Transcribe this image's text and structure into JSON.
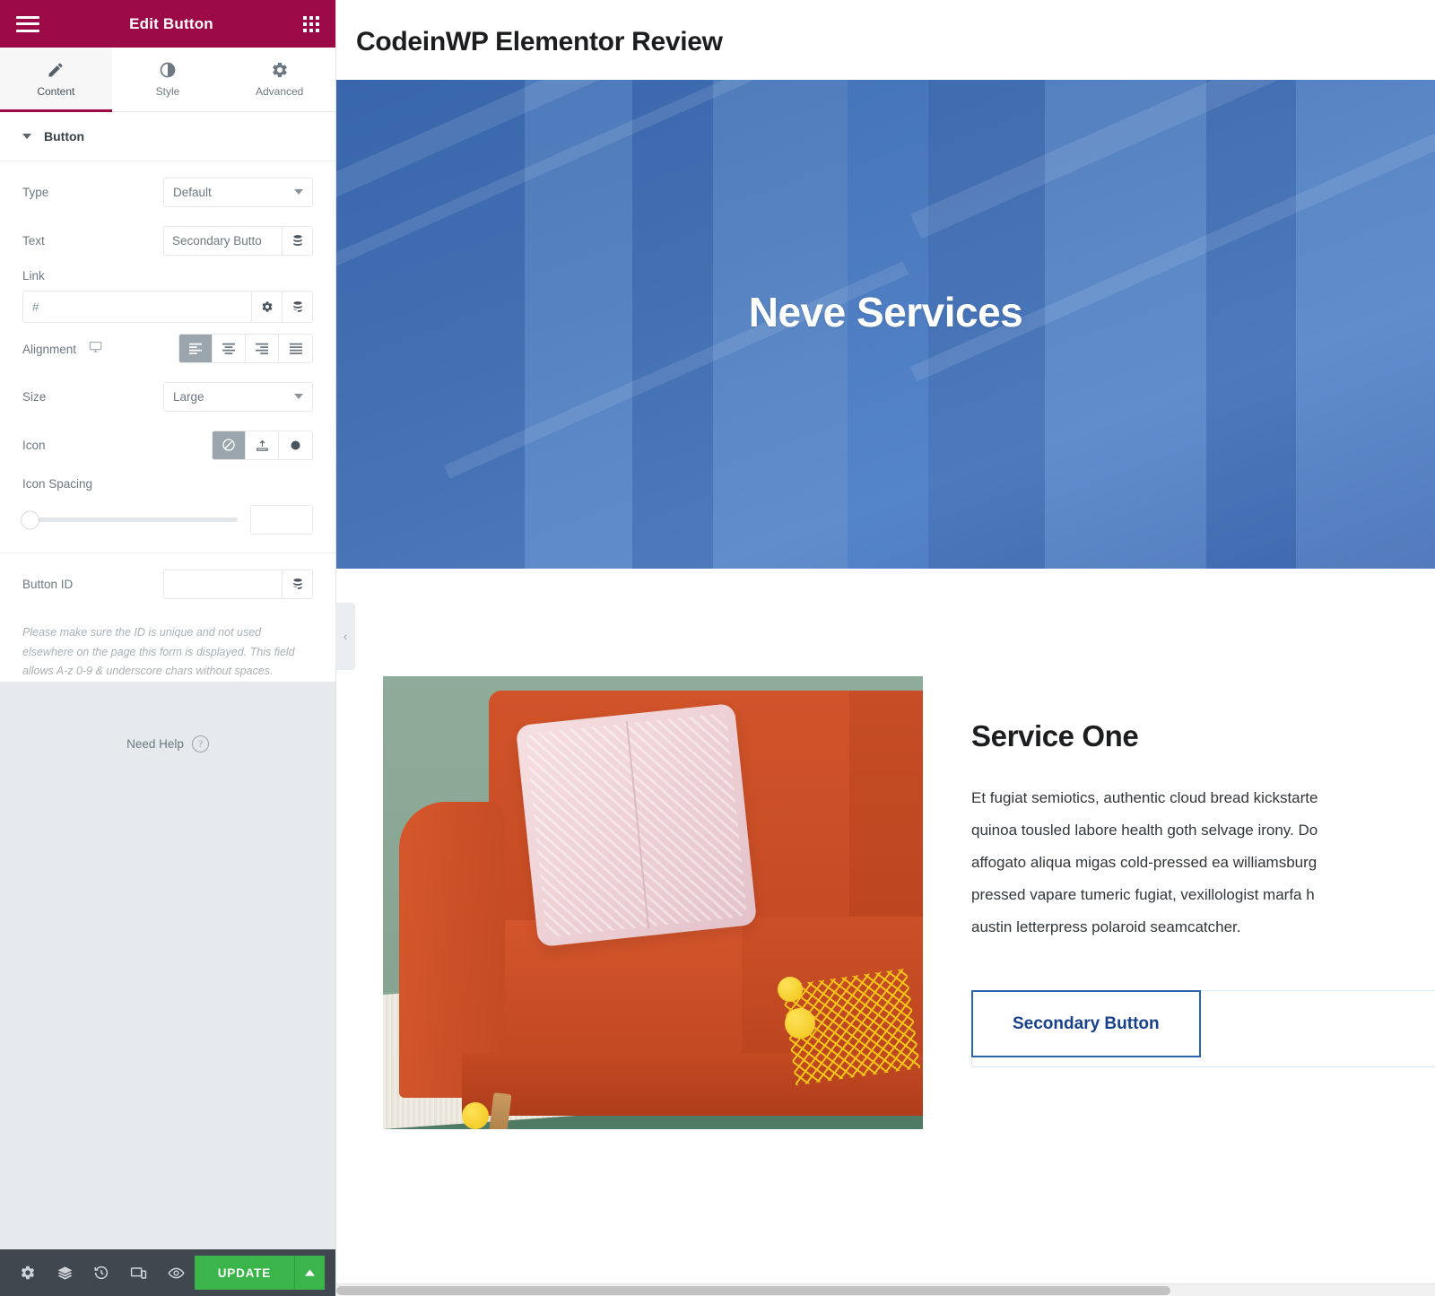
{
  "panel": {
    "header": {
      "title": "Edit Button",
      "menu_icon": "hamburger-icon",
      "apps_icon": "grid-apps-icon"
    },
    "tabs": [
      {
        "label": "Content",
        "icon": "pencil-icon",
        "active": true
      },
      {
        "label": "Style",
        "icon": "half-circle-icon",
        "active": false
      },
      {
        "label": "Advanced",
        "icon": "gear-icon",
        "active": false
      }
    ],
    "section": {
      "title": "Button",
      "collapsed": false
    },
    "fields": {
      "type_label": "Type",
      "type_value": "Default",
      "text_label": "Text",
      "text_value": "Secondary Butto",
      "link_label": "Link",
      "link_value": "#",
      "alignment_label": "Alignment",
      "alignment_options": [
        "align-left",
        "align-center",
        "align-right",
        "align-justify"
      ],
      "alignment_selected": "align-left",
      "size_label": "Size",
      "size_value": "Large",
      "icon_label": "Icon",
      "icon_options": [
        "no-icon",
        "upload-media-icon",
        "icon-library-circle"
      ],
      "icon_selected": "no-icon",
      "icon_spacing_label": "Icon Spacing",
      "icon_spacing_value": "",
      "button_id_label": "Button ID",
      "button_id_value": ""
    },
    "hint": "Please make sure the ID is unique and not used elsewhere on the page this form is displayed. This field allows A-z  0-9 & underscore chars without spaces.",
    "need_help": "Need Help",
    "footer": {
      "icons": [
        "settings-gear-icon",
        "navigator-layers-icon",
        "history-clock-icon",
        "responsive-mode-icon",
        "preview-eye-icon"
      ],
      "update_label": "UPDATE",
      "update_arrow_icon": "chevron-up-icon"
    },
    "collapse_tab_icon": "chevron-left-icon"
  },
  "preview": {
    "site_title": "CodeinWP Elementor Review",
    "hero_title": "Neve Services",
    "service": {
      "title": "Service One",
      "body_lines": [
        "Et fugiat semiotics, authentic cloud bread kickstarte",
        "quinoa tousled labore health goth selvage irony. Do",
        "affogato aliqua migas cold-pressed ea williamsburg",
        "pressed vapare tumeric fugiat, vexillologist marfa h",
        "austin letterpress polaroid seamcatcher."
      ],
      "button_label": "Secondary Button"
    },
    "photo_alt": "orange-sofa-with-pink-pillow-photo"
  },
  "colors": {
    "panel_header": "#9b0a46",
    "accent_tab": "#9b0a46",
    "update_green": "#39b54a",
    "hero_blue": "#4a79bd",
    "button_border_blue": "#2b64ac",
    "button_text_blue": "#17418c",
    "footer_dark": "#41474e",
    "panel_filler": "#e5eaed"
  }
}
